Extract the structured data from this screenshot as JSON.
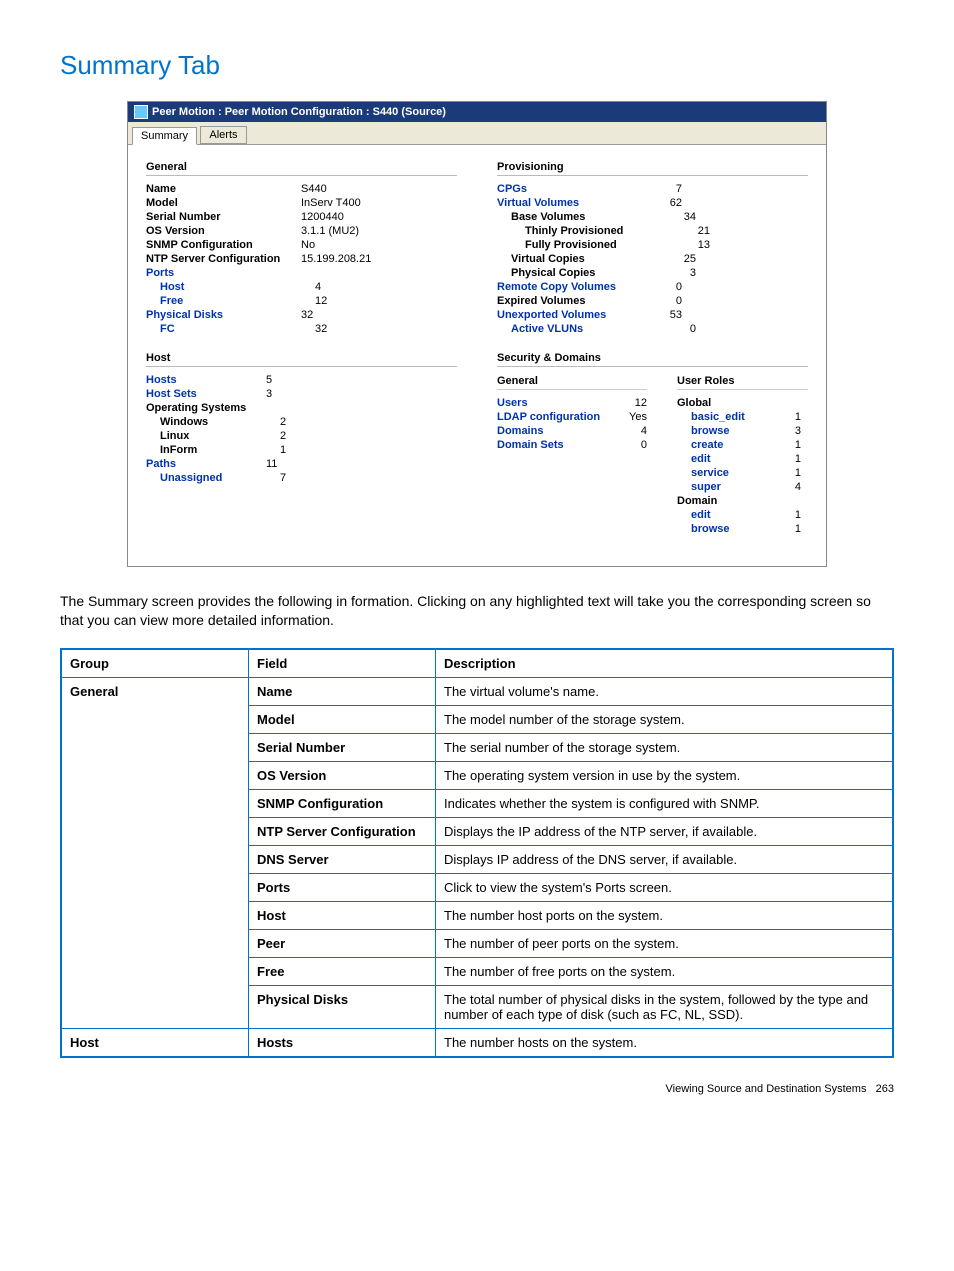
{
  "page_title": "Summary Tab",
  "window_title": "Peer Motion : Peer Motion Configuration : S440 (Source)",
  "tabs": {
    "summary": "Summary",
    "alerts": "Alerts"
  },
  "general": {
    "heading": "General",
    "name_label": "Name",
    "name_val": "S440",
    "model_label": "Model",
    "model_val": "InServ T400",
    "serial_label": "Serial Number",
    "serial_val": "1200440",
    "os_label": "OS Version",
    "os_val": "3.1.1 (MU2)",
    "snmp_label": "SNMP Configuration",
    "snmp_val": "No",
    "ntp_label": "NTP Server Configuration",
    "ntp_val": "15.199.208.21",
    "ports_label": "Ports",
    "ports_host_label": "Host",
    "ports_host_val": "4",
    "ports_free_label": "Free",
    "ports_free_val": "12",
    "pd_label": "Physical Disks",
    "pd_val": "32",
    "fc_label": "FC",
    "fc_val": "32"
  },
  "host": {
    "heading": "Host",
    "hosts_label": "Hosts",
    "hosts_val": "5",
    "hostsets_label": "Host Sets",
    "hostsets_val": "3",
    "os_label": "Operating Systems",
    "windows_label": "Windows",
    "windows_val": "2",
    "linux_label": "Linux",
    "linux_val": "2",
    "inform_label": "InForm",
    "inform_val": "1",
    "paths_label": "Paths",
    "paths_val": "11",
    "unassigned_label": "Unassigned",
    "unassigned_val": "7"
  },
  "prov": {
    "heading": "Provisioning",
    "cpgs_label": "CPGs",
    "cpgs_val": "7",
    "vv_label": "Virtual Volumes",
    "vv_val": "62",
    "base_label": "Base Volumes",
    "base_val": "34",
    "thin_label": "Thinly Provisioned",
    "thin_val": "21",
    "full_label": "Fully Provisioned",
    "full_val": "13",
    "vcopy_label": "Virtual Copies",
    "vcopy_val": "25",
    "pcopy_label": "Physical Copies",
    "pcopy_val": "3",
    "rc_label": "Remote Copy Volumes",
    "rc_val": "0",
    "exp_label": "Expired Volumes",
    "exp_val": "0",
    "unexp_label": "Unexported Volumes",
    "unexp_val": "53",
    "vlun_label": "Active VLUNs",
    "vlun_val": "0"
  },
  "sec": {
    "heading": "Security & Domains",
    "gen_head": "General",
    "roles_head": "User Roles",
    "users_label": "Users",
    "users_val": "12",
    "ldap_label": "LDAP configuration",
    "ldap_val": "Yes",
    "domains_label": "Domains",
    "domains_val": "4",
    "dsets_label": "Domain Sets",
    "dsets_val": "0",
    "global_label": "Global",
    "basic_edit_label": "basic_edit",
    "basic_edit_val": "1",
    "browse_label": "browse",
    "browse_val": "3",
    "create_label": "create",
    "create_val": "1",
    "edit_label": "edit",
    "edit_val": "1",
    "service_label": "service",
    "service_val": "1",
    "super_label": "super",
    "super_val": "4",
    "domain_label": "Domain",
    "dedit_label": "edit",
    "dedit_val": "1",
    "dbrowse_label": "browse",
    "dbrowse_val": "1"
  },
  "description": "The Summary screen provides the following in formation. Clicking on any highlighted text will take you the corresponding screen so that you can view more detailed information.",
  "table": {
    "h_group": "Group",
    "h_field": "Field",
    "h_desc": "Description",
    "g_general": "General",
    "g_host": "Host",
    "f_name": "Name",
    "d_name": "The virtual volume's name.",
    "f_model": "Model",
    "d_model": "The model number of the storage system.",
    "f_serial": "Serial Number",
    "d_serial": "The serial number of the storage system.",
    "f_os": "OS Version",
    "d_os": "The operating system version in use by the system.",
    "f_snmp": "SNMP Configuration",
    "d_snmp": "Indicates whether the system is configured with SNMP.",
    "f_ntp": "NTP Server Configuration",
    "d_ntp": "Displays the IP address of the NTP server, if available.",
    "f_dns": "DNS Server",
    "d_dns": "Displays IP address of the DNS server, if available.",
    "f_ports": "Ports",
    "d_ports": "Click to view the system's Ports screen.",
    "f_host": "Host",
    "d_host": "The number host ports on the system.",
    "f_peer": "Peer",
    "d_peer": "The number of peer ports on the system.",
    "f_free": "Free",
    "d_free": "The number of free ports on the system.",
    "f_pd": "Physical Disks",
    "d_pd": "The total number of physical disks in the system, followed by the type and number of each type of disk (such as FC, NL, SSD).",
    "f_hosts": "Hosts",
    "d_hosts": "The number hosts on the system."
  },
  "footer_text": "Viewing Source and Destination Systems",
  "footer_page": "263"
}
